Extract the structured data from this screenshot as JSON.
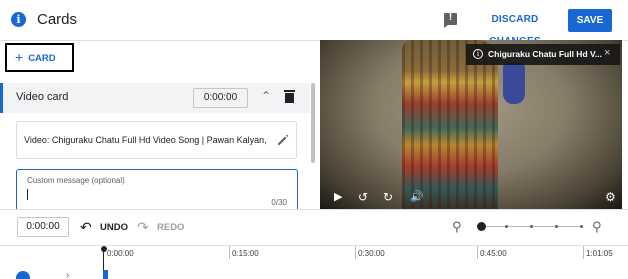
{
  "header": {
    "title": "Cards",
    "discard_label": "DISCARD CHANGES",
    "save_label": "SAVE"
  },
  "left_panel": {
    "add_card_label": "CARD",
    "card": {
      "type_label": "Video card",
      "time": "0:00:00",
      "video_text": "Video: Chiguraku Chatu Full Hd Video Song | Pawan Kalyan, M...",
      "message_placeholder": "Custom message (optional)",
      "message_count": "0/30"
    }
  },
  "player": {
    "title": "Chiguraku Chatu Full Hd V..."
  },
  "timeline": {
    "current_time": "0:00:00",
    "undo_label": "UNDO",
    "redo_label": "REDO",
    "ticks": [
      "0:00:00",
      "0:15:00",
      "0:30:00",
      "0:45:00",
      "1:01:05"
    ]
  }
}
